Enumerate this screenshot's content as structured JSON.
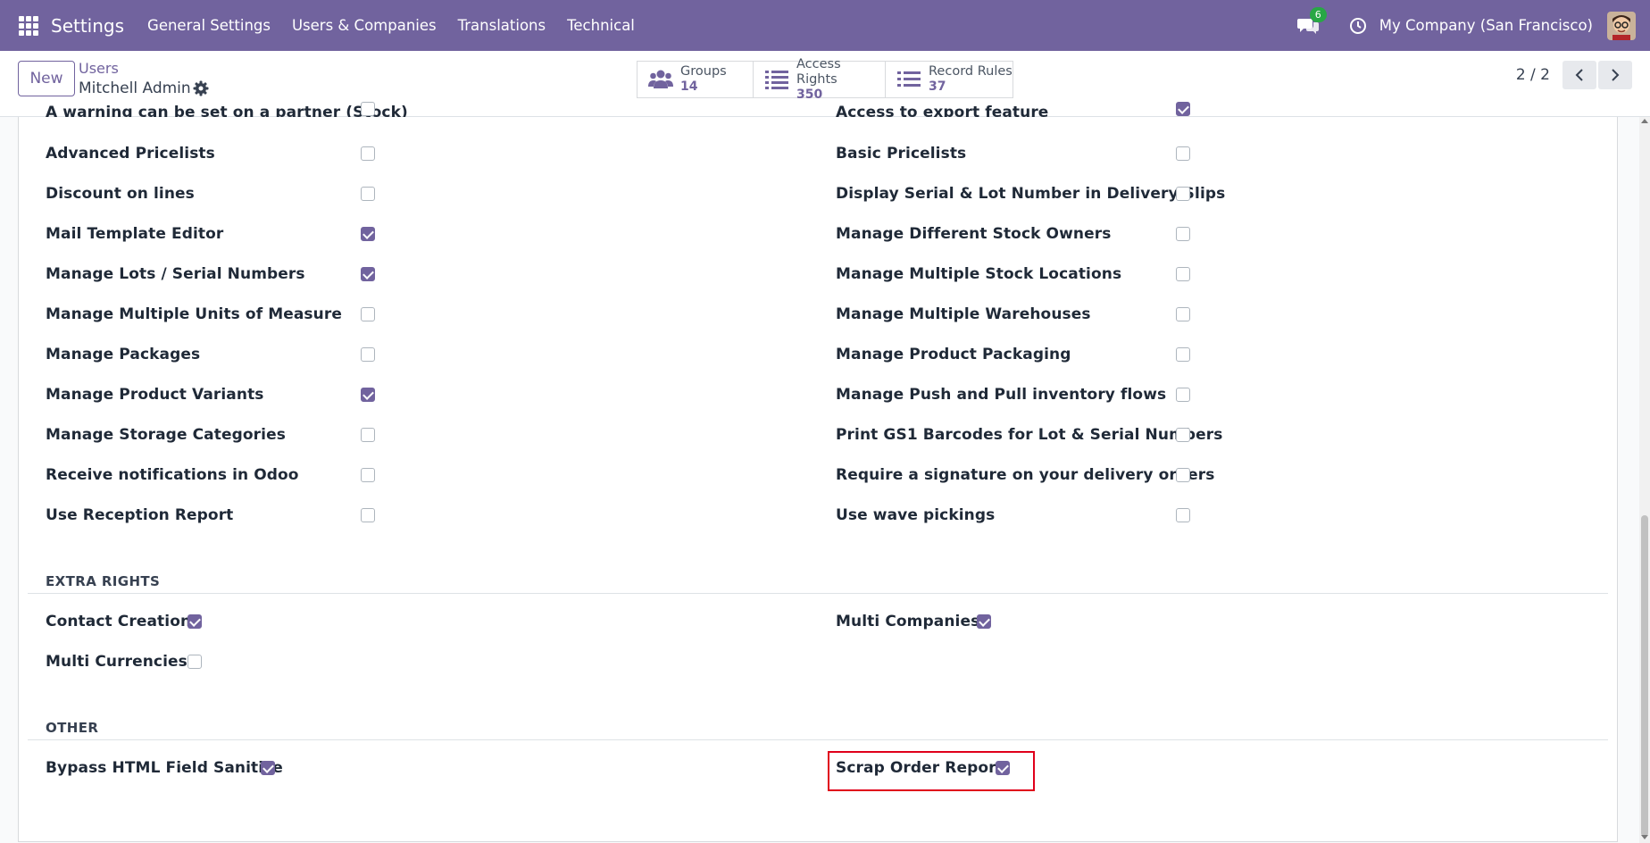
{
  "navbar": {
    "app_name": "Settings",
    "menus": [
      "General Settings",
      "Users & Companies",
      "Translations",
      "Technical"
    ],
    "chat_count": "6",
    "company": "My Company (San Francisco)"
  },
  "control": {
    "new_label": "New",
    "breadcrumb_parent": "Users",
    "breadcrumb_current": "Mitchell Admin",
    "smart_buttons": [
      {
        "label": "Groups",
        "value": "14",
        "icon": "users-icon"
      },
      {
        "label": "Access Rights",
        "value": "350",
        "icon": "list-icon"
      },
      {
        "label": "Record Rules",
        "value": "37",
        "icon": "list-icon"
      }
    ],
    "pager": "2 / 2"
  },
  "partial_row": {
    "left": "A warning can be set on a partner (Stock)",
    "right": "Access to export feature"
  },
  "technical_rows": [
    {
      "left": "Advanced Pricelists",
      "left_checked": false,
      "right": "Basic Pricelists",
      "right_checked": false
    },
    {
      "left": "Discount on lines",
      "left_checked": false,
      "right": "Display Serial & Lot Number in Delivery Slips",
      "right_checked": false
    },
    {
      "left": "Mail Template Editor",
      "left_checked": true,
      "right": "Manage Different Stock Owners",
      "right_checked": false
    },
    {
      "left": "Manage Lots / Serial Numbers",
      "left_checked": true,
      "right": "Manage Multiple Stock Locations",
      "right_checked": false
    },
    {
      "left": "Manage Multiple Units of Measure",
      "left_checked": false,
      "right": "Manage Multiple Warehouses",
      "right_checked": false
    },
    {
      "left": "Manage Packages",
      "left_checked": false,
      "right": "Manage Product Packaging",
      "right_checked": false
    },
    {
      "left": "Manage Product Variants",
      "left_checked": true,
      "right": "Manage Push and Pull inventory flows",
      "right_checked": false
    },
    {
      "left": "Manage Storage Categories",
      "left_checked": false,
      "right": "Print GS1 Barcodes for Lot & Serial Numbers",
      "right_checked": false
    },
    {
      "left": "Receive notifications in Odoo",
      "left_checked": false,
      "right": "Require a signature on your delivery orders",
      "right_checked": false
    },
    {
      "left": "Use Reception Report",
      "left_checked": false,
      "right": "Use wave pickings",
      "right_checked": false
    }
  ],
  "extra_rights": {
    "title": "EXTRA RIGHTS",
    "items": [
      {
        "label": "Contact Creation",
        "checked": true
      },
      {
        "label": "Multi Companies",
        "checked": true
      },
      {
        "label": "Multi Currencies",
        "checked": false
      }
    ]
  },
  "other": {
    "title": "OTHER",
    "items": [
      {
        "label": "Bypass HTML Field Sanitize",
        "checked": true
      },
      {
        "label": "Scrap Order Report",
        "checked": true
      }
    ]
  },
  "colors": {
    "brand": "#71639e",
    "badge": "#28a745",
    "highlight": "#e0001b"
  }
}
